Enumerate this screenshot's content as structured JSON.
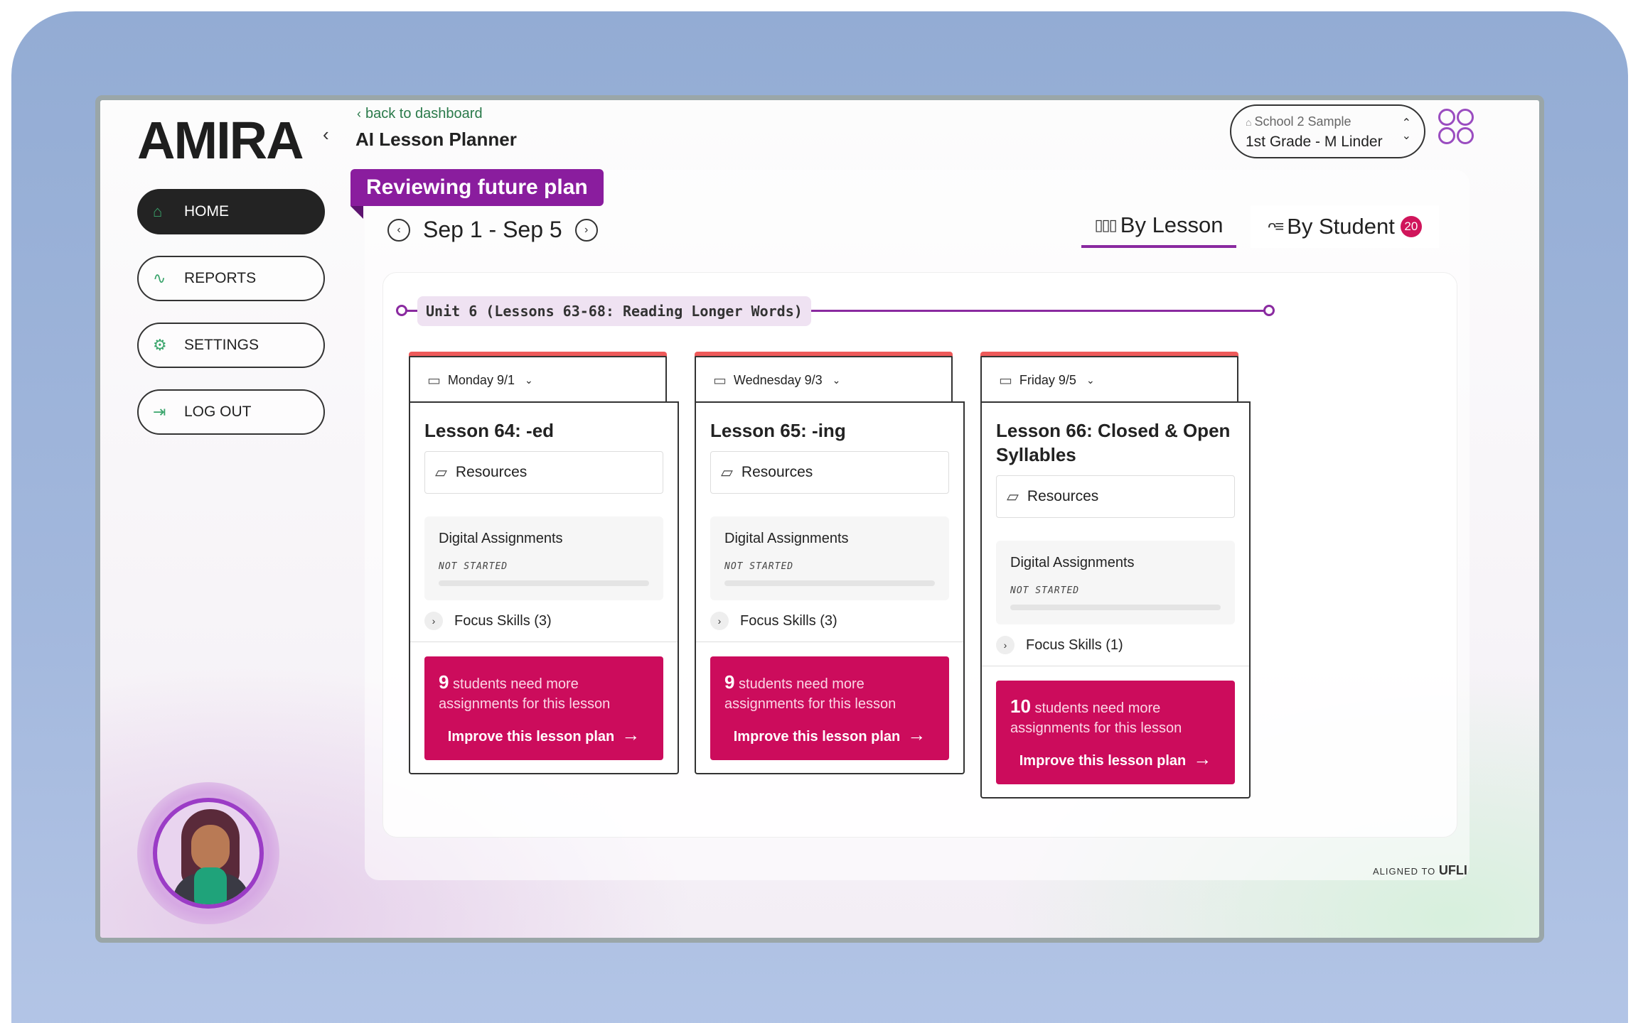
{
  "app": {
    "logo": "AMIRA",
    "collapse_icon": "chevron-left-icon",
    "back_link": "back to dashboard",
    "page_title": "AI Lesson Planner"
  },
  "school_selector": {
    "school": "School 2 Sample",
    "class": "1st Grade - M Linder"
  },
  "sidebar": {
    "items": [
      {
        "label": "HOME",
        "icon": "home-icon",
        "active": true
      },
      {
        "label": "REPORTS",
        "icon": "reports-icon",
        "active": false
      },
      {
        "label": "SETTINGS",
        "icon": "gear-icon",
        "active": false
      },
      {
        "label": "LOG OUT",
        "icon": "logout-icon",
        "active": false
      }
    ]
  },
  "planner": {
    "badge": "Reviewing future plan",
    "date_range": "Sep 1 - Sep 5",
    "tabs": {
      "by_lesson": "By Lesson",
      "by_student": "By Student",
      "student_count": "20"
    },
    "unit_label": "Unit 6 (Lessons 63-68: Reading Longer Words)",
    "aligned_prefix": "ALIGNED TO",
    "aligned_brand": "UFLI"
  },
  "cards": [
    {
      "day": "Monday 9/1",
      "title": "Lesson 64: -ed",
      "resources": "Resources",
      "digital_title": "Digital Assignments",
      "status": "NOT STARTED",
      "progress": 0,
      "focus": "Focus Skills (3)",
      "count": "9",
      "msg": "students need more assignments for this lesson",
      "cta": "Improve this lesson plan"
    },
    {
      "day": "Wednesday 9/3",
      "title": "Lesson 65: -ing",
      "resources": "Resources",
      "digital_title": "Digital Assignments",
      "status": "NOT STARTED",
      "progress": 0,
      "focus": "Focus Skills (3)",
      "count": "9",
      "msg": "students need more assignments for this lesson",
      "cta": "Improve this lesson plan"
    },
    {
      "day": "Friday 9/5",
      "title": "Lesson 66: Closed & Open Syllables",
      "resources": "Resources",
      "digital_title": "Digital Assignments",
      "status": "NOT STARTED",
      "progress": 0,
      "focus": "Focus Skills (1)",
      "count": "10",
      "msg": "students need more assignments for this lesson",
      "cta": "Improve this lesson plan"
    }
  ],
  "colors": {
    "accent_purple": "#8a1d9e",
    "cta_pink": "#cc0c5c",
    "card_top_red": "#ee5a5a",
    "nav_icon_green": "#3aa56c"
  }
}
